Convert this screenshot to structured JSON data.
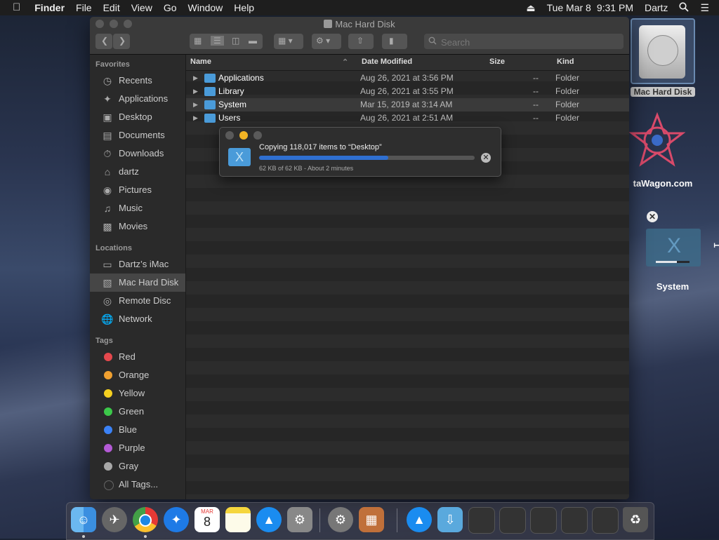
{
  "menubar": {
    "apple": "",
    "app": "Finder",
    "menus": [
      "File",
      "Edit",
      "View",
      "Go",
      "Window",
      "Help"
    ],
    "date": "Tue Mar 8",
    "time": "9:31 PM",
    "user": "Dartz"
  },
  "desktop": {
    "items": [
      {
        "label": "Mac Hard Disk"
      },
      {
        "label": "taWagon.com"
      },
      {
        "label": "System"
      }
    ]
  },
  "window": {
    "title": "Mac Hard Disk",
    "search_placeholder": "Search"
  },
  "sidebar": {
    "favorites_label": "Favorites",
    "favorites": [
      {
        "label": "Recents",
        "icon": "clock-icon"
      },
      {
        "label": "Applications",
        "icon": "applications-icon"
      },
      {
        "label": "Desktop",
        "icon": "desktop-icon"
      },
      {
        "label": "Documents",
        "icon": "document-icon"
      },
      {
        "label": "Downloads",
        "icon": "download-icon"
      },
      {
        "label": "dartz",
        "icon": "home-icon"
      },
      {
        "label": "Pictures",
        "icon": "camera-icon"
      },
      {
        "label": "Music",
        "icon": "music-icon"
      },
      {
        "label": "Movies",
        "icon": "film-icon"
      }
    ],
    "locations_label": "Locations",
    "locations": [
      {
        "label": "Dartz’s iMac",
        "icon": "imac-icon"
      },
      {
        "label": "Mac Hard Disk",
        "icon": "disk-icon"
      },
      {
        "label": "Remote Disc",
        "icon": "disc-icon"
      },
      {
        "label": "Network",
        "icon": "network-icon"
      }
    ],
    "tags_label": "Tags",
    "tags": [
      {
        "label": "Red",
        "color": "#e5484d"
      },
      {
        "label": "Orange",
        "color": "#f0a030"
      },
      {
        "label": "Yellow",
        "color": "#f5d020"
      },
      {
        "label": "Green",
        "color": "#3cc84a"
      },
      {
        "label": "Blue",
        "color": "#3b82f6"
      },
      {
        "label": "Purple",
        "color": "#b45ad6"
      },
      {
        "label": "Gray",
        "color": "#a8a8a8"
      },
      {
        "label": "All Tags...",
        "color": "#555555"
      }
    ]
  },
  "list": {
    "headers": {
      "name": "Name",
      "date": "Date Modified",
      "size": "Size",
      "kind": "Kind"
    },
    "rows": [
      {
        "name": "Applications",
        "date": "Aug 26, 2021 at 3:56 PM",
        "size": "--",
        "kind": "Folder"
      },
      {
        "name": "Library",
        "date": "Aug 26, 2021 at 3:55 PM",
        "size": "--",
        "kind": "Folder"
      },
      {
        "name": "System",
        "date": "Mar 15, 2019 at 3:14 AM",
        "size": "--",
        "kind": "Folder"
      },
      {
        "name": "Users",
        "date": "Aug 26, 2021 at 2:51 AM",
        "size": "--",
        "kind": "Folder"
      }
    ]
  },
  "copy_dialog": {
    "title": "Copying 118,017 items to “Desktop”",
    "subtitle": "62 KB of 62 KB - About 2 minutes",
    "progress": 0.6
  },
  "dock": {
    "items": [
      "finder-icon",
      "launchpad-icon",
      "chrome-icon",
      "safari-icon",
      "calendar-icon",
      "notes-icon",
      "app-store-icon",
      "system-preferences-icon",
      "automator-icon",
      "archive-icon",
      "app-store-downloads-icon",
      "downloads-folder-icon",
      "screenshot-1-icon",
      "screenshot-2-icon",
      "screenshot-3-icon",
      "screenshot-4-icon",
      "screenshot-5-icon",
      "trash-icon"
    ],
    "calendar_month": "MAR",
    "calendar_day": "8"
  }
}
